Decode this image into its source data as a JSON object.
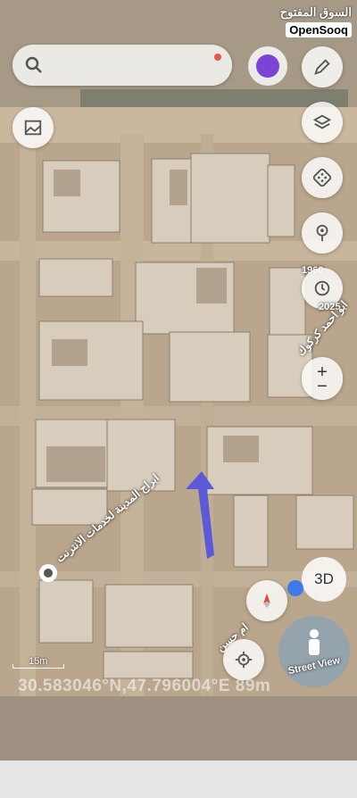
{
  "watermark": {
    "arabic": "السوق المفتوح",
    "english": "OpenSooq"
  },
  "search": {
    "placeholder": ""
  },
  "timeline": {
    "start_year": "1960",
    "end_year": "2025"
  },
  "labels": {
    "place1": "ابراج المدينة لخدمات الانترنت",
    "place2": "ابو احمد كركوك",
    "place3": "ام حسن"
  },
  "controls": {
    "three_d_label": "3D",
    "street_view_label": "Street View",
    "zoom_in": "+",
    "zoom_out": "−"
  },
  "scale": {
    "label": "15m"
  },
  "coordinates": {
    "text": "30.583046°N,47.796004°E 89m"
  },
  "colors": {
    "accent": "#6a5ae0",
    "route_arrow": "#5c5ad8",
    "ground": "#b8a48a"
  },
  "icons": [
    "search-icon",
    "gallery-icon",
    "layers-icon",
    "dice-icon",
    "location-pin-icon",
    "history-icon",
    "compass-icon",
    "locate-icon",
    "street-view-person-icon",
    "pencil-icon"
  ]
}
